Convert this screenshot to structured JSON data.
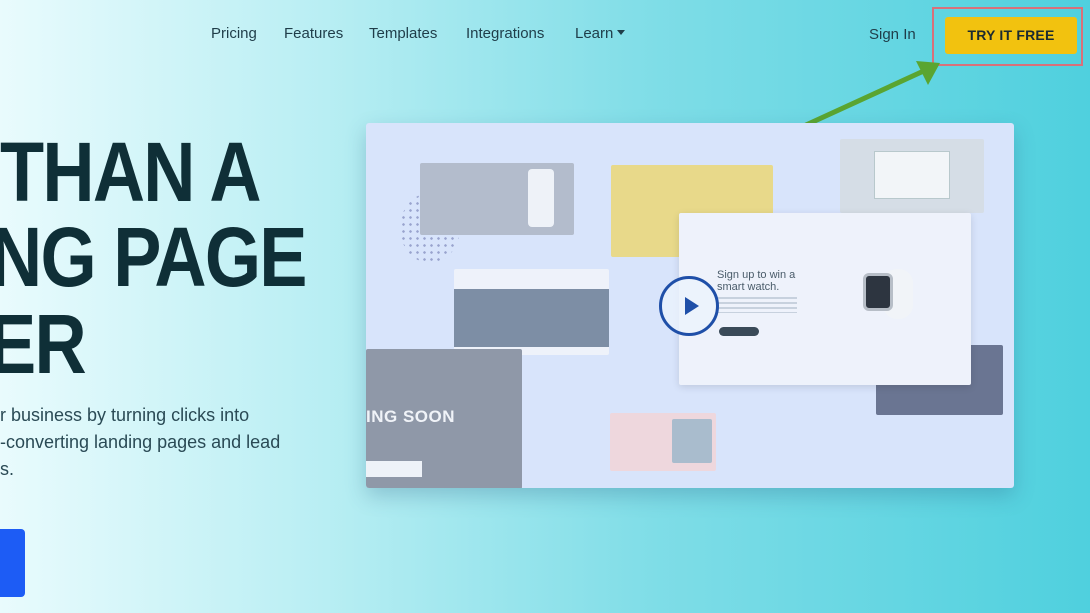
{
  "nav": {
    "items": [
      {
        "label": "Pricing"
      },
      {
        "label": "Features"
      },
      {
        "label": "Templates"
      },
      {
        "label": "Integrations"
      },
      {
        "label": "Learn"
      }
    ],
    "sign_in": "Sign In",
    "cta": "TRY IT FREE"
  },
  "hero": {
    "line1": "THAN A",
    "line2": "NG PAGE",
    "line3": "ER",
    "subtitle": [
      "r business by turning clicks into",
      "-converting landing pages and lead",
      "s."
    ]
  },
  "video_panel": {
    "coming_soon": "ING SOON",
    "card_headline": [
      "Sign up to win a",
      "smart watch."
    ]
  },
  "colors": {
    "cta_bg": "#f2c20f",
    "highlight_border": "#d9707a",
    "arrow": "#5aa531",
    "primary_blue": "#1d5cf5",
    "play_icon": "#1f4fa8"
  }
}
